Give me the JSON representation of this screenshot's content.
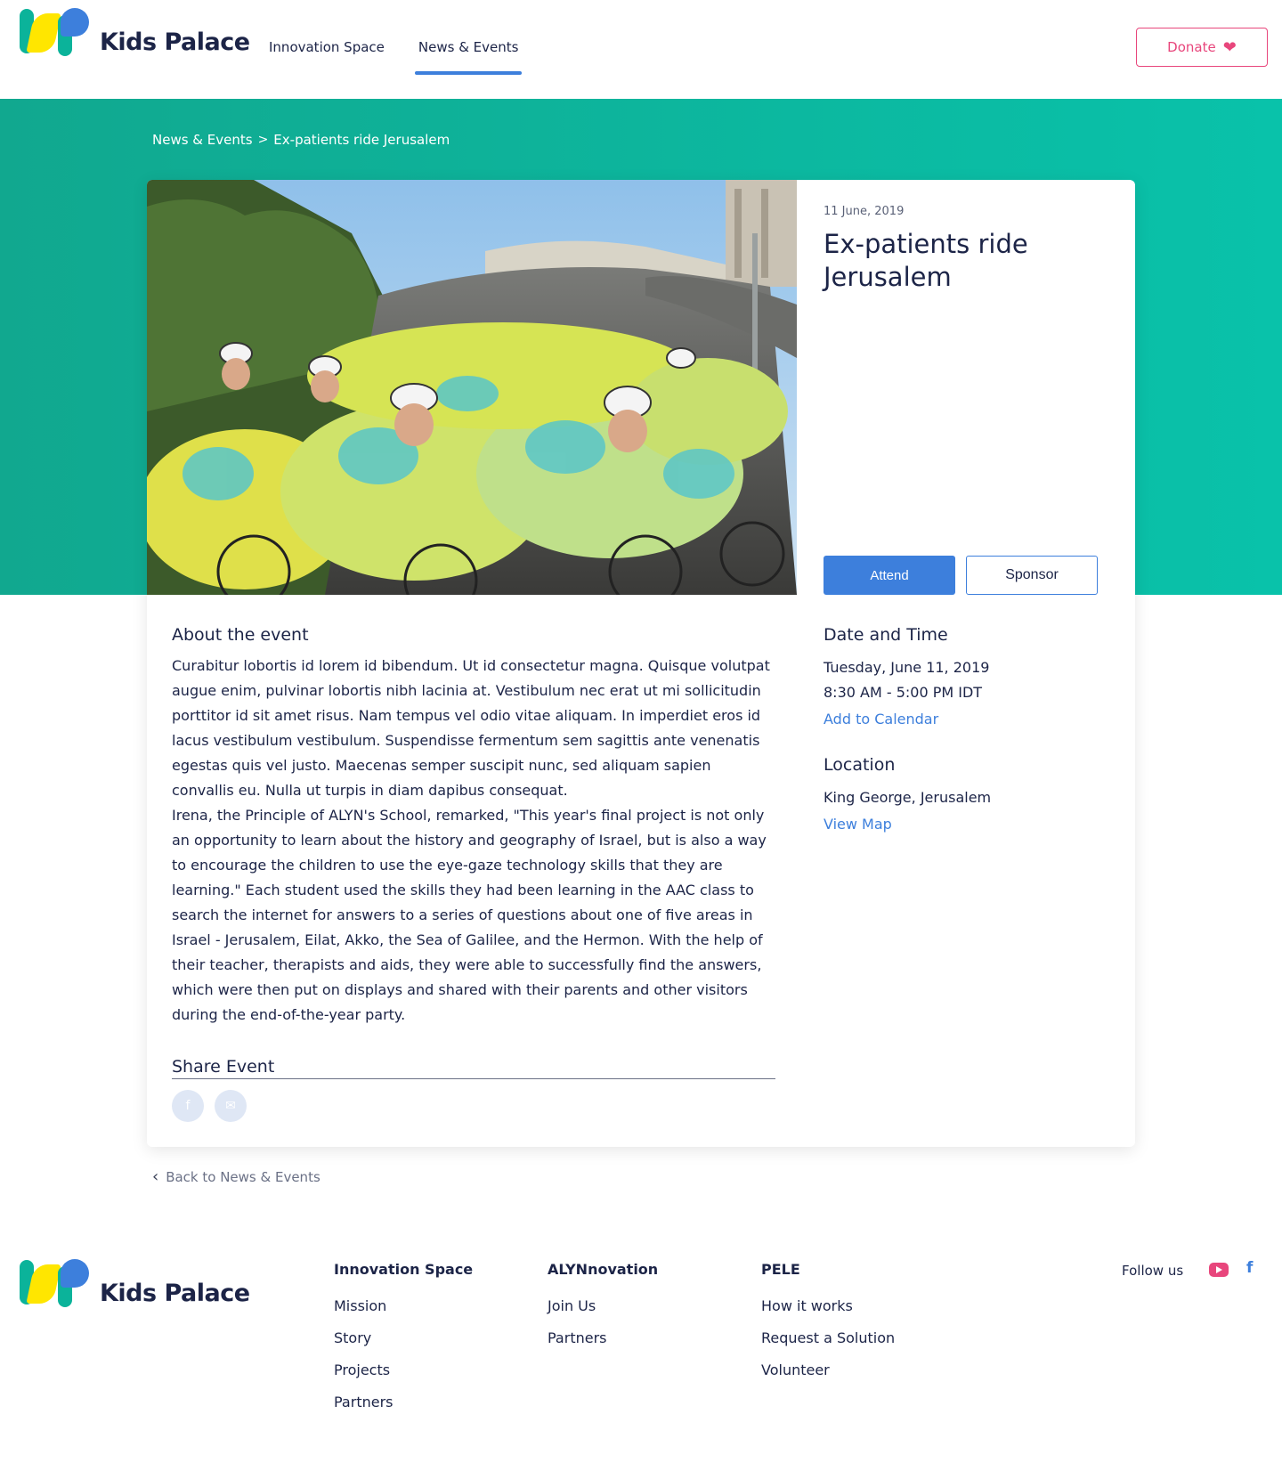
{
  "brand": {
    "name": "Kids Palace"
  },
  "nav": {
    "items": [
      {
        "label": "Innovation Space"
      },
      {
        "label": "News & Events"
      }
    ]
  },
  "header": {
    "donate_label": "Donate"
  },
  "breadcrumb": {
    "parent": "News & Events",
    "separator": ">",
    "current": "Ex-patients ride Jerusalem"
  },
  "event": {
    "date_short": "11 June, 2019",
    "title": "Ex-patients ride Jerusalem",
    "attend_label": "Attend",
    "sponsor_label": "Sponsor"
  },
  "about": {
    "heading": "About the event",
    "paragraph1": "Curabitur lobortis id lorem id bibendum. Ut id consectetur magna. Quisque volutpat augue enim, pulvinar lobortis nibh lacinia at. Vestibulum nec erat ut mi sollicitudin porttitor id sit amet risus. Nam tempus vel odio vitae aliquam. In imperdiet eros id lacus vestibulum vestibulum. Suspendisse fermentum sem sagittis ante venenatis egestas quis vel justo. Maecenas semper suscipit nunc, sed aliquam sapien convallis eu. Nulla ut turpis in diam dapibus consequat.",
    "paragraph2": "Irena, the Principle of ALYN's School, remarked, \"This year's final project is not only an opportunity to learn about the history and geography of Israel, but is also a way to encourage the children to use the eye-gaze technology skills that they are learning.\" Each student used the skills they had been learning in the AAC class to search the internet for answers to a series of questions about one of five areas in Israel - Jerusalem, Eilat, Akko, the Sea of Galilee, and the Hermon. With the help of their teacher, therapists and aids, they were able to successfully find the answers, which were then put on displays and shared with their parents and other visitors during the end-of-the-year party."
  },
  "share": {
    "heading": "Share Event",
    "facebook_glyph": "f",
    "email_glyph": "✉"
  },
  "details": {
    "datetime_heading": "Date and Time",
    "date": "Tuesday, June 11, 2019",
    "time": "8:30 AM - 5:00 PM IDT",
    "calendar_link": "Add to Calendar",
    "location_heading": "Location",
    "location": "King George, Jerusalem",
    "map_link": "View Map"
  },
  "back_link": "Back to News & Events",
  "footer": {
    "columns": [
      {
        "heading": "Innovation Space",
        "links": [
          "Mission",
          "Story",
          "Projects",
          "Partners"
        ]
      },
      {
        "heading": "ALYNnovation",
        "links": [
          "Join Us",
          "Partners"
        ]
      },
      {
        "heading": "PELE",
        "links": [
          "How it works",
          "Request a Solution",
          "Volunteer"
        ]
      }
    ],
    "follow_label": "Follow us",
    "social_icons": [
      "youtube-icon",
      "facebook-icon"
    ],
    "facebook_glyph": "f"
  },
  "colors": {
    "accent_blue": "#3d7fdc",
    "teal": "#0bb39a",
    "donate_pink": "#e8467c",
    "navy": "#1c2447"
  }
}
